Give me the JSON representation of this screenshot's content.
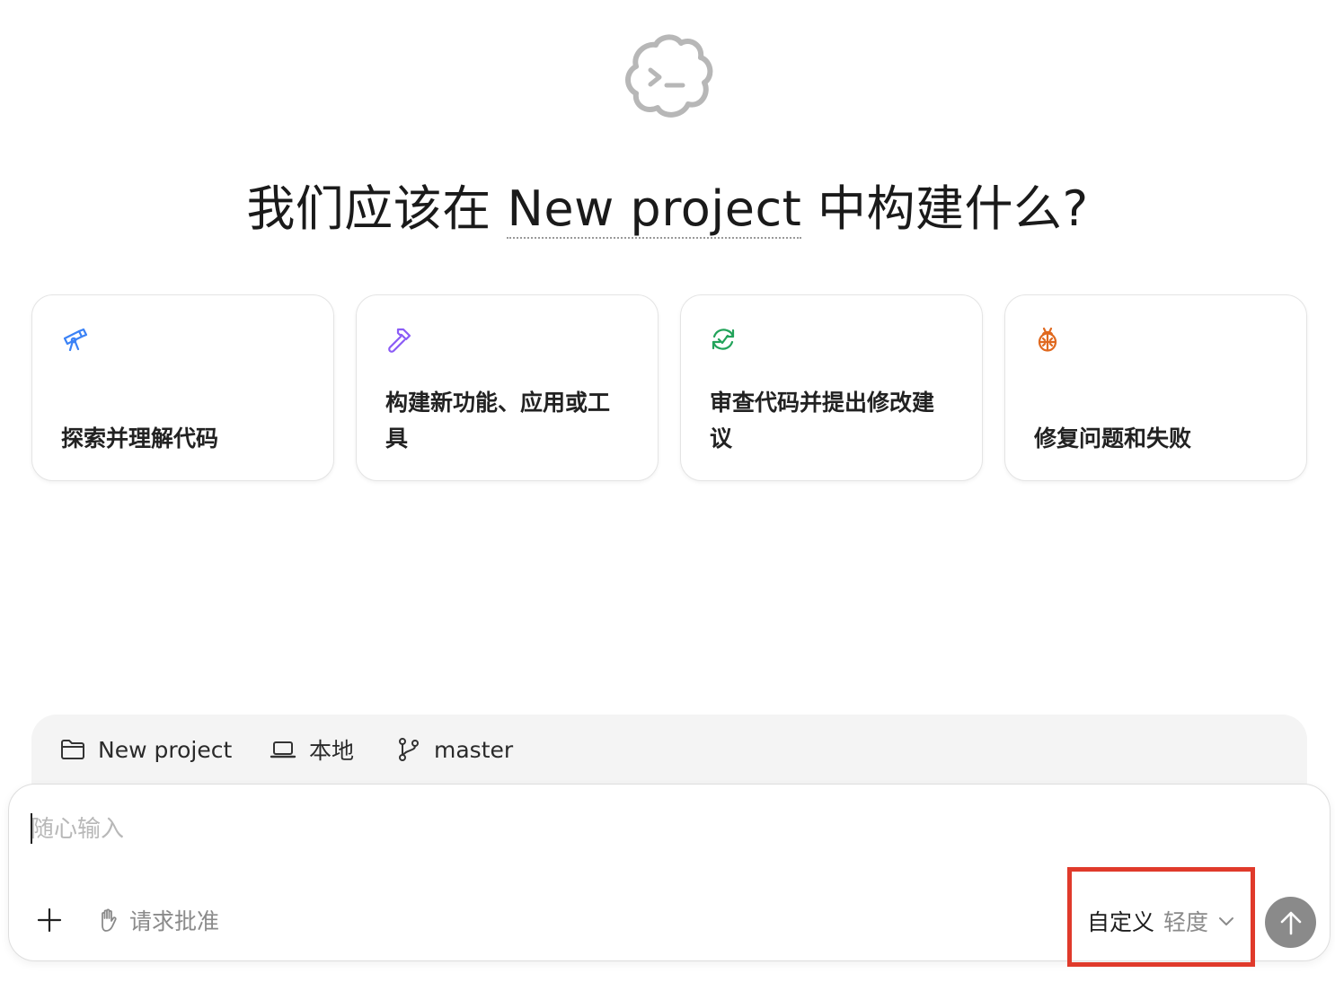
{
  "headline": {
    "prefix": "我们应该在 ",
    "project": "New project",
    "suffix": " 中构建什么?"
  },
  "cards": [
    {
      "label": "探索并理解代码",
      "icon": "telescope-icon",
      "color": "#3b82f6"
    },
    {
      "label": "构建新功能、应用或工具",
      "icon": "hammer-icon",
      "color": "#8b5cf6"
    },
    {
      "label": "审查代码并提出修改建议",
      "icon": "review-refresh-icon",
      "color": "#22a35a"
    },
    {
      "label": "修复问题和失败",
      "icon": "bug-icon",
      "color": "#e0691f"
    }
  ],
  "context": {
    "project": "New project",
    "location": "本地",
    "branch": "master"
  },
  "composer": {
    "placeholder": "随心输入",
    "approval": "请求批准",
    "model_name": "自定义",
    "model_level": "轻度"
  },
  "colors": {
    "highlight": "#e03a2b",
    "send_button": "#8a8a8a",
    "context_bar": "#f4f4f4"
  }
}
